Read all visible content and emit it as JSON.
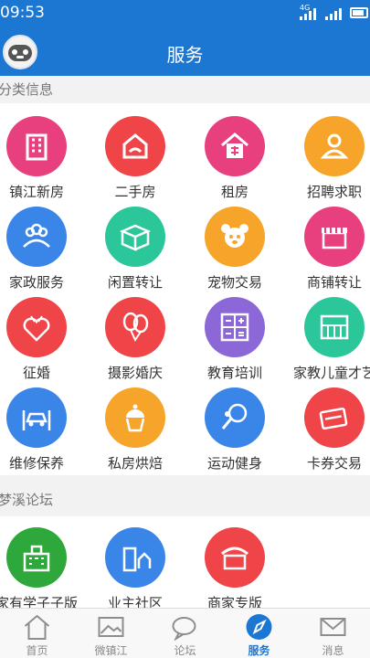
{
  "status_bar": {
    "time": "09:53",
    "network_label": "4G"
  },
  "header": {
    "title": "服务"
  },
  "sections": {
    "classified": {
      "title": "分类信息",
      "items": [
        {
          "label": "镇江新房",
          "icon": "building-icon",
          "color": "#e8407f"
        },
        {
          "label": "二手房",
          "icon": "house-hand-icon",
          "color": "#ef4448"
        },
        {
          "label": "租房",
          "icon": "house-rent-icon",
          "color": "#e8407f"
        },
        {
          "label": "招聘求职",
          "icon": "person-icon",
          "color": "#f7a52a"
        },
        {
          "label": "家政服务",
          "icon": "group-icon",
          "color": "#3a86e8"
        },
        {
          "label": "闲置转让",
          "icon": "box-icon",
          "color": "#2bc69a"
        },
        {
          "label": "宠物交易",
          "icon": "pet-icon",
          "color": "#f7a52a"
        },
        {
          "label": "商铺转让",
          "icon": "shop-icon",
          "color": "#e8407f"
        },
        {
          "label": "征婚",
          "icon": "hearts-icon",
          "color": "#ef4448"
        },
        {
          "label": "摄影婚庆",
          "icon": "balloon-icon",
          "color": "#ef4448"
        },
        {
          "label": "教育培训",
          "icon": "calculator-icon",
          "color": "#8b67d8"
        },
        {
          "label": "家教儿童才艺",
          "icon": "piano-icon",
          "color": "#2bc69a"
        },
        {
          "label": "维修保养",
          "icon": "car-lift-icon",
          "color": "#3a86e8"
        },
        {
          "label": "私房烘焙",
          "icon": "cupcake-icon",
          "color": "#f7a52a"
        },
        {
          "label": "运动健身",
          "icon": "racket-icon",
          "color": "#3a86e8"
        },
        {
          "label": "卡券交易",
          "icon": "card-icon",
          "color": "#ef4448"
        }
      ]
    },
    "forum": {
      "title": "梦溪论坛",
      "items": [
        {
          "label": "家有学子子版",
          "icon": "school-icon",
          "color": "#2ea83b"
        },
        {
          "label": "业主社区",
          "icon": "community-icon",
          "color": "#3a86e8"
        },
        {
          "label": "商家专版",
          "icon": "store-icon",
          "color": "#ef4448"
        }
      ]
    }
  },
  "tab_bar": {
    "active_color": "#1b77d2",
    "items": [
      {
        "label": "首页",
        "icon": "home-icon"
      },
      {
        "label": "微镇江",
        "icon": "image-icon"
      },
      {
        "label": "论坛",
        "icon": "chat-icon"
      },
      {
        "label": "服务",
        "icon": "compass-icon",
        "active": true
      },
      {
        "label": "消息",
        "icon": "mail-icon"
      }
    ]
  }
}
